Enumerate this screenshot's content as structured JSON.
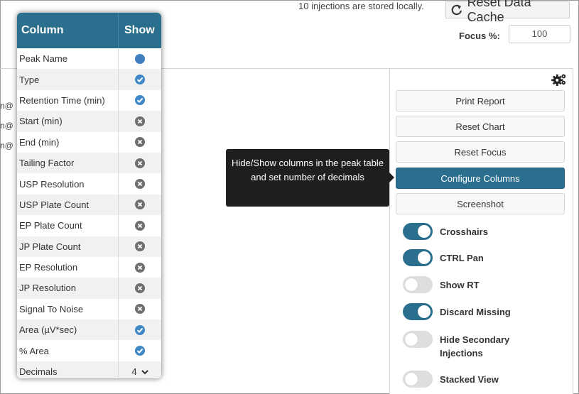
{
  "top": {
    "status_text": "10 injections are stored locally.",
    "reset_cache_label": "Reset Data Cache",
    "focus_label": "Focus %:",
    "focus_value": "100"
  },
  "left_fragments": [
    "n@",
    "n@",
    "n@"
  ],
  "tooltip": "Hide/Show columns in the peak table and set number of decimals",
  "panel": {
    "buttons": [
      {
        "label": "Print Report",
        "active": false
      },
      {
        "label": "Reset Chart",
        "active": false
      },
      {
        "label": "Reset Focus",
        "active": false
      },
      {
        "label": "Configure Columns",
        "active": true
      },
      {
        "label": "Screenshot",
        "active": false
      }
    ],
    "toggles": [
      {
        "label": "Crosshairs",
        "on": true
      },
      {
        "label": "CTRL Pan",
        "on": true
      },
      {
        "label": "Show RT",
        "on": false
      },
      {
        "label": "Discard Missing",
        "on": true
      },
      {
        "label": "Hide Secondary Injections",
        "on": false
      },
      {
        "label": "Stacked View",
        "on": false
      }
    ]
  },
  "columns_popup": {
    "header_column": "Column",
    "header_show": "Show",
    "rows": [
      {
        "name": "Peak Name",
        "state": "circle"
      },
      {
        "name": "Type",
        "state": "check"
      },
      {
        "name": "Retention Time (min)",
        "state": "check"
      },
      {
        "name": "Start (min)",
        "state": "x"
      },
      {
        "name": "End (min)",
        "state": "x"
      },
      {
        "name": "Tailing Factor",
        "state": "x"
      },
      {
        "name": "USP Resolution",
        "state": "x"
      },
      {
        "name": "USP Plate Count",
        "state": "x"
      },
      {
        "name": "EP Plate Count",
        "state": "x"
      },
      {
        "name": "JP Plate Count",
        "state": "x"
      },
      {
        "name": "EP Resolution",
        "state": "x"
      },
      {
        "name": "JP Resolution",
        "state": "x"
      },
      {
        "name": "Signal To Noise",
        "state": "x"
      },
      {
        "name": "Area (µV*sec)",
        "state": "check"
      },
      {
        "name": "% Area",
        "state": "check"
      }
    ],
    "decimals_label": "Decimals",
    "decimals_value": "4"
  },
  "colors": {
    "accent": "#2b6f8e",
    "check_blue": "#3f88c5",
    "disabled_gray": "#6f6f6f",
    "tooltip_bg": "#1f1f1f"
  },
  "icons": {
    "reset": "refresh-icon",
    "settings": "gears-icon",
    "decimals": "chevron-down-icon"
  }
}
